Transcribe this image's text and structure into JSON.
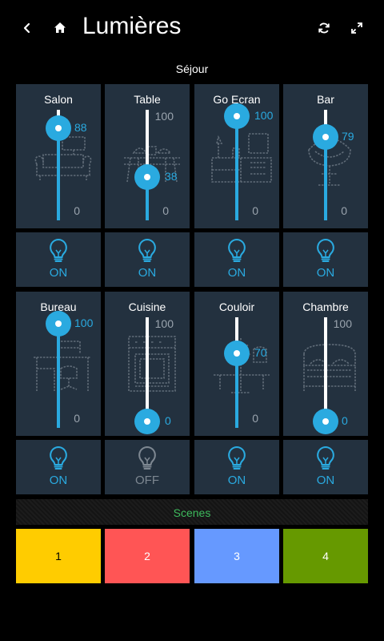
{
  "header": {
    "title": "Lumières",
    "icons": [
      "back-icon",
      "home-icon",
      "refresh-icon",
      "fullscreen-icon"
    ]
  },
  "section": {
    "title": "Séjour"
  },
  "colors": {
    "accent": "#2aaae0",
    "tile": "#23313f",
    "off": "#7d8791",
    "scenes_label": "#3dba5c"
  },
  "dimmers": [
    {
      "name": "Salon",
      "value": 88,
      "min": 0,
      "max": 100,
      "show_max": false,
      "icon": "sofa-icon",
      "state": "ON"
    },
    {
      "name": "Table",
      "value": 38,
      "min": 0,
      "max": 100,
      "show_max": true,
      "icon": "dining-table-icon",
      "state": "ON"
    },
    {
      "name": "Go Ecran",
      "value": 100,
      "min": 0,
      "max": 100,
      "show_max": false,
      "icon": "tv-cabinet-icon",
      "state": "ON"
    },
    {
      "name": "Bar",
      "value": 79,
      "min": 0,
      "max": 100,
      "show_max": false,
      "icon": "bar-chair-icon",
      "state": "ON"
    },
    {
      "name": "Bureau",
      "value": 100,
      "min": 0,
      "max": 100,
      "show_max": false,
      "icon": "desk-icon",
      "state": "ON"
    },
    {
      "name": "Cuisine",
      "value": 0,
      "min": 0,
      "max": 100,
      "show_max": true,
      "icon": "oven-icon",
      "state": "OFF"
    },
    {
      "name": "Couloir",
      "value": 70,
      "min": 0,
      "max": 100,
      "show_max": false,
      "icon": "coat-rack-icon",
      "state": "ON"
    },
    {
      "name": "Chambre",
      "value": 0,
      "min": 0,
      "max": 100,
      "show_max": true,
      "icon": "bed-icon",
      "state": "ON"
    }
  ],
  "scenes": {
    "label": "Scenes",
    "buttons": [
      {
        "label": "1",
        "color": "#ffcc00",
        "text_color": "#000000"
      },
      {
        "label": "2",
        "color": "#ff5555",
        "text_color": "#ffffff"
      },
      {
        "label": "3",
        "color": "#6699ff",
        "text_color": "#ffffff"
      },
      {
        "label": "4",
        "color": "#669900",
        "text_color": "#ffffff"
      }
    ]
  }
}
